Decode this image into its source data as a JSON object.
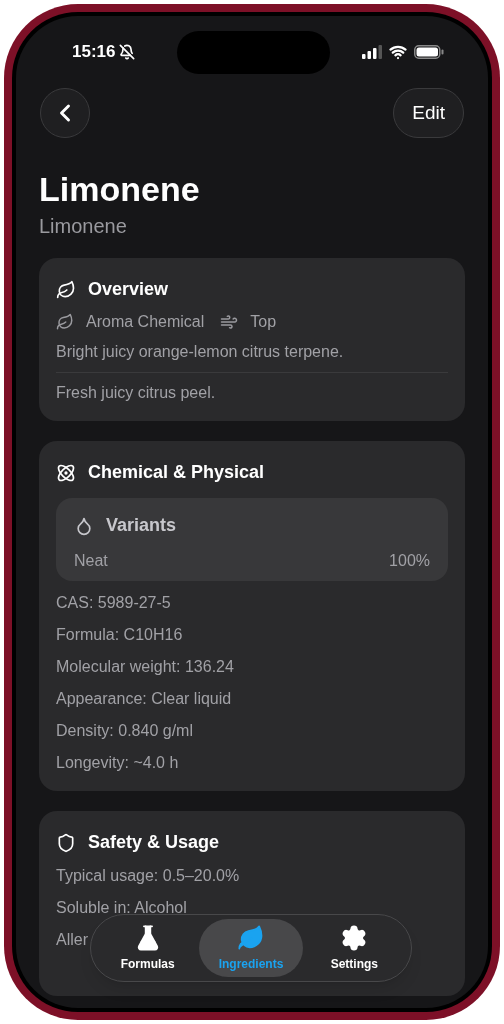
{
  "status_bar": {
    "time": "15:16",
    "silent": true
  },
  "nav": {
    "edit_button": "Edit"
  },
  "title": "Limonene",
  "subtitle": "Limonene",
  "sections": [
    {
      "kind": "overview",
      "title": "Overview",
      "tags": [
        {
          "kind": "leaf",
          "label": "Aroma Chemical"
        },
        {
          "kind": "wind",
          "label": "Top"
        }
      ],
      "description": "Bright juicy orange-lemon citrus terpene.",
      "notes": "Fresh juicy citrus peel."
    },
    {
      "kind": "chemical",
      "title": "Chemical & Physical",
      "variants": {
        "title": "Variants",
        "rows": [
          {
            "name": "Neat",
            "value": "100%"
          }
        ]
      },
      "lines": [
        "CAS: 5989-27-5",
        "Formula: C10H16",
        "Molecular weight: 136.24",
        "Appearance: Clear liquid",
        "Density: 0.840 g/ml",
        "Longevity: ~4.0 h"
      ]
    },
    {
      "kind": "safety",
      "title": "Safety & Usage",
      "lines": [
        "Typical usage: 0.5–20.0%",
        "Soluble in: Alcohol",
        "Aller"
      ]
    }
  ],
  "tab_bar": [
    {
      "kind": "flask",
      "label": "Formulas",
      "selected": false
    },
    {
      "kind": "leaf",
      "label": "Ingredients",
      "selected": true
    },
    {
      "kind": "gear",
      "label": "Settings",
      "selected": false
    }
  ]
}
